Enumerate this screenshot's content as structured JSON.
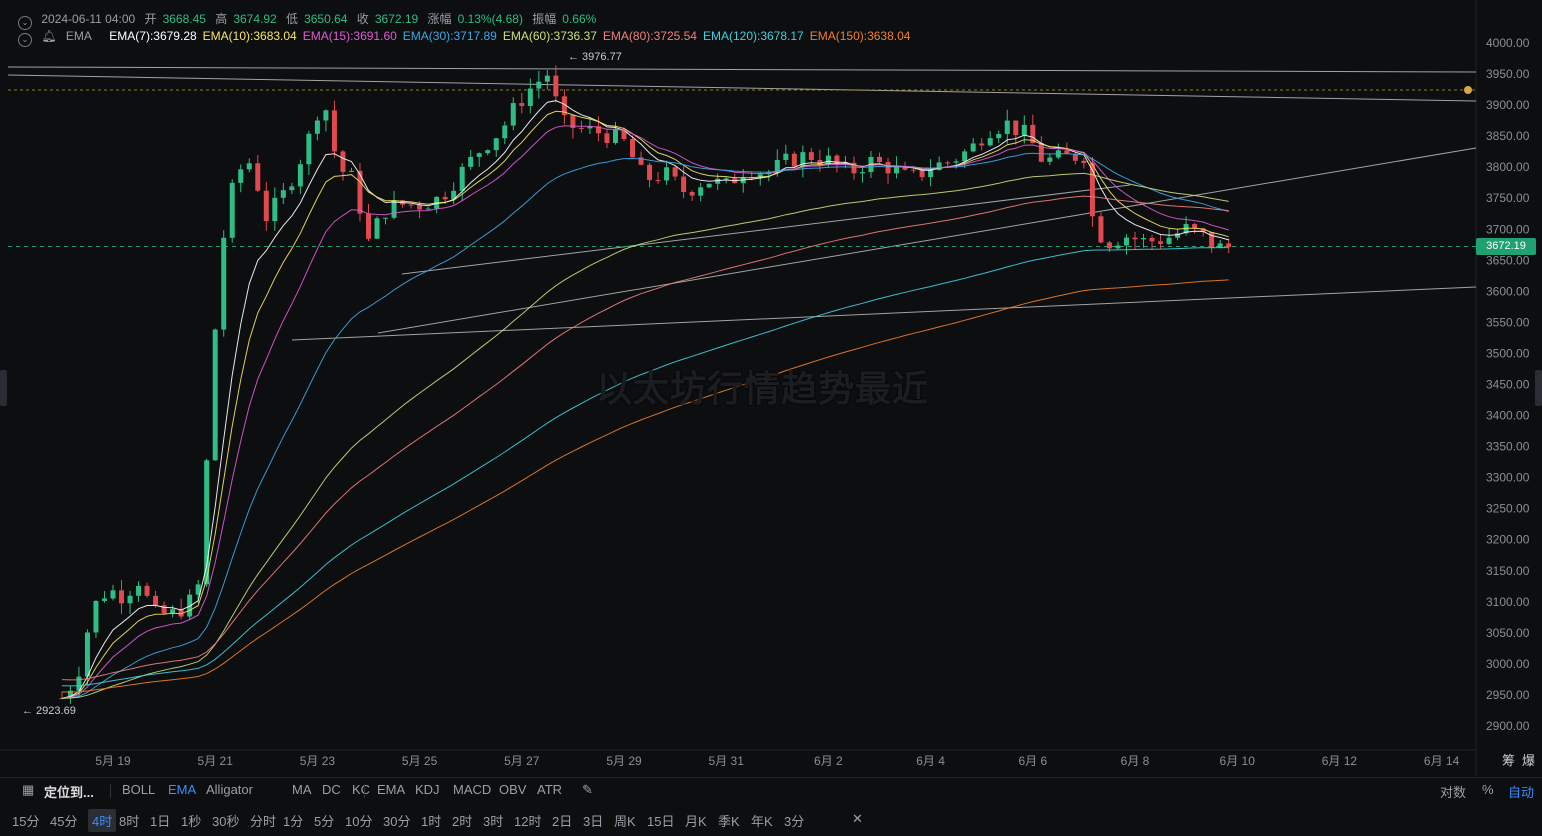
{
  "header": {
    "datetime": "2024-06-11 04:00",
    "open_label": "开",
    "open": "3668.45",
    "high_label": "高",
    "high": "3674.92",
    "low_label": "低",
    "low": "3650.64",
    "close_label": "收",
    "close": "3672.19",
    "change_label": "涨幅",
    "change": "0.13%(4.68)",
    "amp_label": "振幅",
    "amp": "0.66%"
  },
  "ema_bar": {
    "name": "EMA",
    "items": [
      {
        "label": "EMA(7):3679.28",
        "color": "#ffffff"
      },
      {
        "label": "EMA(10):3683.04",
        "color": "#f5e663"
      },
      {
        "label": "EMA(15):3691.60",
        "color": "#e05bd6"
      },
      {
        "label": "EMA(30):3717.89",
        "color": "#3fa7e8"
      },
      {
        "label": "EMA(60):3736.37",
        "color": "#c8e07a"
      },
      {
        "label": "EMA(80):3725.54",
        "color": "#f08080"
      },
      {
        "label": "EMA(120):3678.17",
        "color": "#3fd0e0"
      },
      {
        "label": "EMA(150):3638.04",
        "color": "#f0802a"
      }
    ]
  },
  "watermark": "以太坊行情趋势最近",
  "current_price": "3672.19",
  "high_marker": "3976.77",
  "low_marker": "2923.69",
  "chart_data": {
    "type": "candlestick",
    "x_ticks": [
      "5月 19",
      "5月 21",
      "5月 23",
      "5月 25",
      "5月 27",
      "5月 29",
      "5月 31",
      "6月 2",
      "6月 4",
      "6月 6",
      "6月 8",
      "6月 10",
      "6月 12",
      "6月 14"
    ],
    "y_ticks": [
      "4000.00",
      "3950.00",
      "3900.00",
      "3850.00",
      "3800.00",
      "3750.00",
      "3700.00",
      "3650.00",
      "3600.00",
      "3550.00",
      "3500.00",
      "3450.00",
      "3400.00",
      "3350.00",
      "3300.00",
      "3250.00",
      "3200.00",
      "3150.00",
      "3100.00",
      "3050.00",
      "3000.00",
      "2950.00",
      "2900.00"
    ],
    "ylim": [
      2900,
      4000
    ],
    "corner_labels": [
      "筹",
      "爆"
    ],
    "close_path": [
      {
        "day": 18.0,
        "close": 2945
      },
      {
        "day": 18.3,
        "close": 2980
      },
      {
        "day": 18.6,
        "close": 3090
      },
      {
        "day": 18.9,
        "close": 3120
      },
      {
        "day": 19.2,
        "close": 3110
      },
      {
        "day": 19.5,
        "close": 3135
      },
      {
        "day": 19.8,
        "close": 3080
      },
      {
        "day": 20.2,
        "close": 3080
      },
      {
        "day": 20.5,
        "close": 3100
      },
      {
        "day": 20.7,
        "close": 3130
      },
      {
        "day": 20.9,
        "close": 3420
      },
      {
        "day": 21.1,
        "close": 3660
      },
      {
        "day": 21.4,
        "close": 3790
      },
      {
        "day": 21.7,
        "close": 3810
      },
      {
        "day": 22.0,
        "close": 3720
      },
      {
        "day": 22.3,
        "close": 3750
      },
      {
        "day": 22.6,
        "close": 3800
      },
      {
        "day": 22.9,
        "close": 3860
      },
      {
        "day": 23.1,
        "close": 3920
      },
      {
        "day": 23.4,
        "close": 3800
      },
      {
        "day": 23.7,
        "close": 3780
      },
      {
        "day": 24.0,
        "close": 3680
      },
      {
        "day": 24.3,
        "close": 3730
      },
      {
        "day": 24.6,
        "close": 3740
      },
      {
        "day": 25.0,
        "close": 3740
      },
      {
        "day": 25.4,
        "close": 3750
      },
      {
        "day": 25.8,
        "close": 3790
      },
      {
        "day": 26.2,
        "close": 3830
      },
      {
        "day": 26.6,
        "close": 3860
      },
      {
        "day": 26.9,
        "close": 3900
      },
      {
        "day": 27.2,
        "close": 3930
      },
      {
        "day": 27.5,
        "close": 3950
      },
      {
        "day": 27.8,
        "close": 3870
      },
      {
        "day": 28.2,
        "close": 3860
      },
      {
        "day": 28.6,
        "close": 3855
      },
      {
        "day": 29.0,
        "close": 3840
      },
      {
        "day": 29.4,
        "close": 3780
      },
      {
        "day": 29.8,
        "close": 3790
      },
      {
        "day": 30.2,
        "close": 3760
      },
      {
        "day": 30.6,
        "close": 3780
      },
      {
        "day": 31.0,
        "close": 3770
      },
      {
        "day": 31.4,
        "close": 3800
      },
      {
        "day": 31.8,
        "close": 3790
      },
      {
        "day": 32.2,
        "close": 3810
      },
      {
        "day": 32.6,
        "close": 3820
      },
      {
        "day": 33.0,
        "close": 3810
      },
      {
        "day": 33.4,
        "close": 3790
      },
      {
        "day": 33.8,
        "close": 3810
      },
      {
        "day": 34.2,
        "close": 3800
      },
      {
        "day": 34.6,
        "close": 3780
      },
      {
        "day": 35.0,
        "close": 3800
      },
      {
        "day": 35.4,
        "close": 3810
      },
      {
        "day": 35.8,
        "close": 3830
      },
      {
        "day": 36.1,
        "close": 3860
      },
      {
        "day": 36.5,
        "close": 3870
      },
      {
        "day": 36.9,
        "close": 3850
      },
      {
        "day": 37.2,
        "close": 3810
      },
      {
        "day": 37.6,
        "close": 3815
      },
      {
        "day": 38.0,
        "close": 3820
      },
      {
        "day": 38.2,
        "close": 3700
      },
      {
        "day": 38.5,
        "close": 3680
      },
      {
        "day": 38.8,
        "close": 3690
      },
      {
        "day": 39.2,
        "close": 3680
      },
      {
        "day": 39.6,
        "close": 3685
      },
      {
        "day": 40.0,
        "close": 3700
      },
      {
        "day": 40.3,
        "close": 3690
      },
      {
        "day": 40.6,
        "close": 3670
      },
      {
        "day": 40.9,
        "close": 3672
      }
    ]
  },
  "toolbar": {
    "locate": "定位到...",
    "indicators_main": [
      "BOLL",
      "EMA",
      "Alligator",
      "MA",
      "DC",
      "KC"
    ],
    "indicators_sub": [
      "EMA",
      "KDJ",
      "MACD",
      "OBV",
      "ATR"
    ],
    "right": [
      "对数",
      "%",
      "自动"
    ]
  },
  "timeframes": [
    "15分",
    "45分",
    "4时",
    "8时",
    "1日",
    "1秒",
    "30秒",
    "分时",
    "1分",
    "5分",
    "10分",
    "30分",
    "1时",
    "2时",
    "3时",
    "12时",
    "2日",
    "3日",
    "周K",
    "15日",
    "月K",
    "季K",
    "年K",
    "3分"
  ],
  "active_timeframe": "4时",
  "active_indicator": "EMA"
}
